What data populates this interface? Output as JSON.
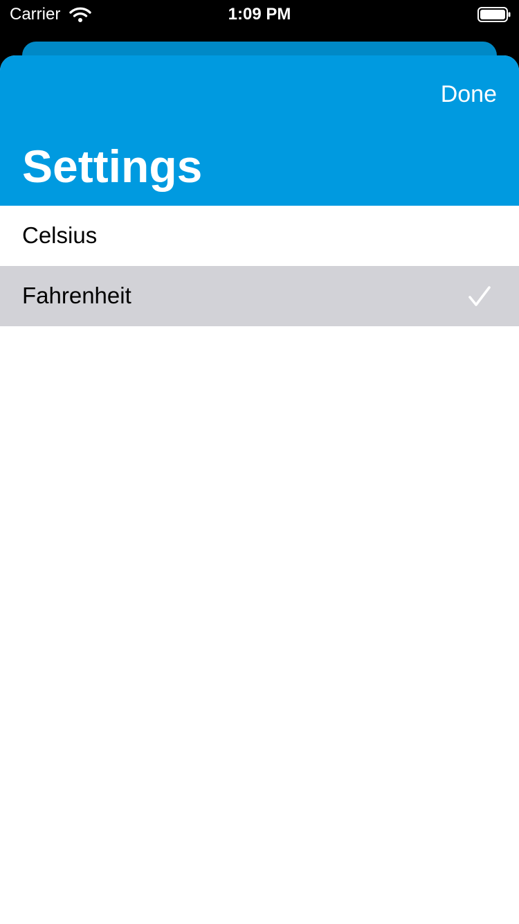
{
  "status_bar": {
    "carrier": "Carrier",
    "time": "1:09 PM"
  },
  "nav": {
    "done_label": "Done",
    "title": "Settings",
    "color": "#009ae0"
  },
  "options": [
    {
      "label": "Celsius",
      "selected": false
    },
    {
      "label": "Fahrenheit",
      "selected": true
    }
  ],
  "colors": {
    "selected_row": "#d2d2d7",
    "checkmark": "#ffffff"
  },
  "icons": [
    "wifi-icon",
    "battery-icon",
    "checkmark-icon"
  ]
}
